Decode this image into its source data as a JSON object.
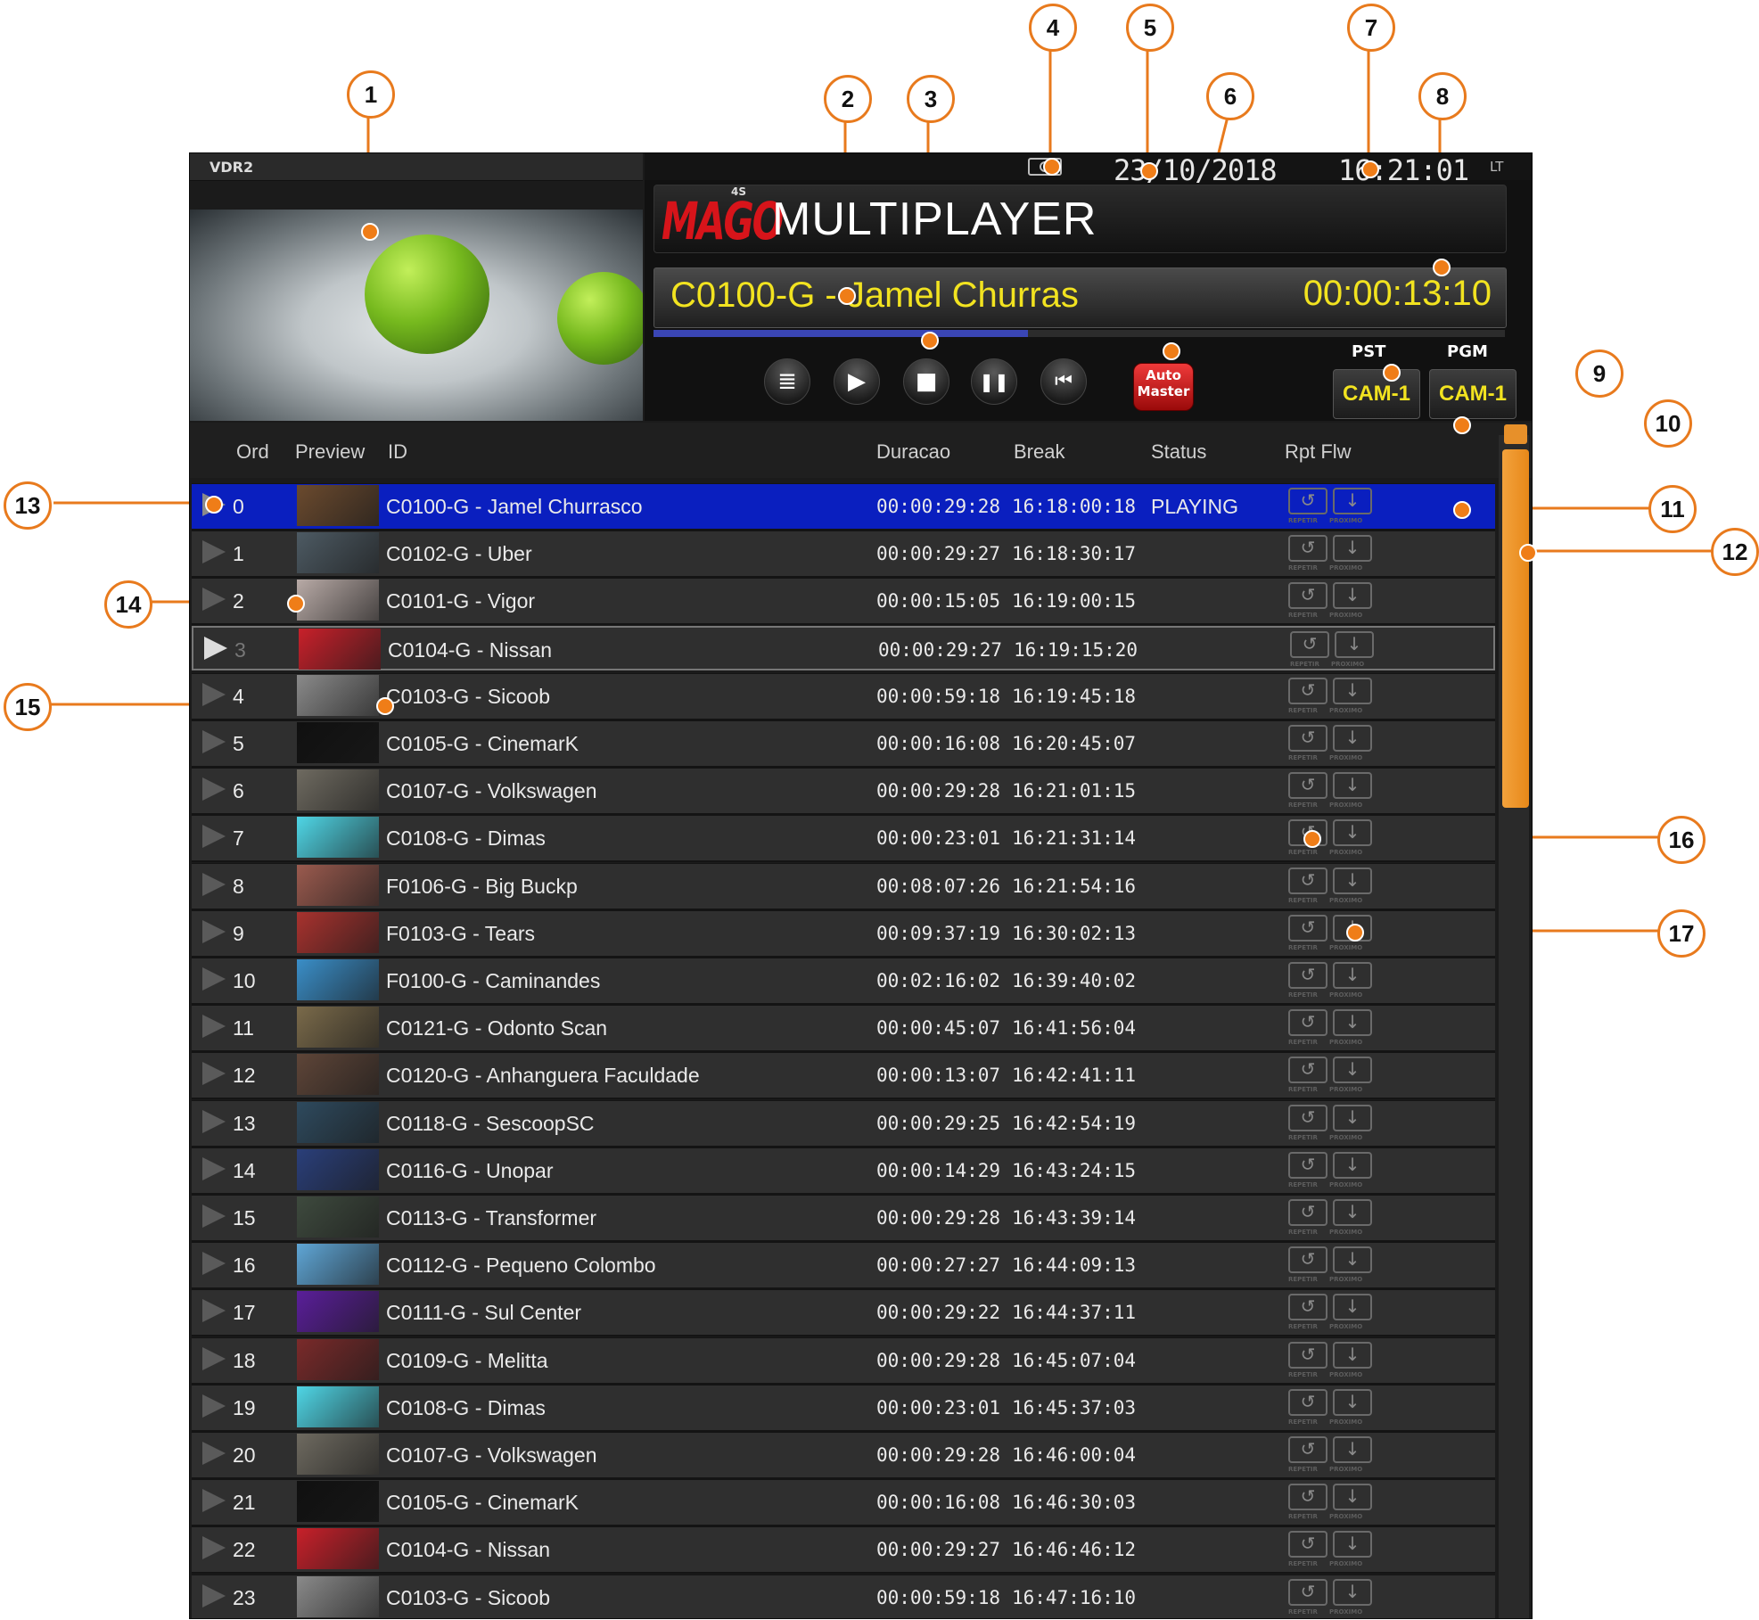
{
  "app": {
    "channel_label": "VDR2",
    "brand_logo": "MAGO",
    "brand_sup": "4S",
    "title": "MULTIPLAYER"
  },
  "status": {
    "date": "23/10/2018",
    "time": "16:21:01",
    "time_zone": "LT"
  },
  "now_playing": {
    "title": "C0100-G - Jamel Churras",
    "timer": "00:00:13:10",
    "progress": 0.44
  },
  "transport": {
    "list_glyph": "≣",
    "play_glyph": "▶",
    "stop_glyph": "■",
    "pause_glyph": "❚❚",
    "restart_glyph": "⏮",
    "auto_master_line1": "Auto",
    "auto_master_line2": "Master"
  },
  "routing": {
    "pst_label": "PST",
    "pgm_label": "PGM",
    "pst_value": "CAM-1",
    "pgm_value": "CAM-1"
  },
  "table": {
    "columns": {
      "ord": "Ord",
      "preview": "Preview",
      "id": "ID",
      "duration": "Duracao",
      "break": "Break",
      "status": "Status",
      "rpt_flw": "Rpt Flw"
    },
    "icon_captions": {
      "rpt": "REPETIR",
      "flw": "PROXIMO"
    },
    "rows": [
      {
        "ord": "0",
        "id": "C0100-G - Jamel Churrasco",
        "duration": "00:00:29:28",
        "break": "16:18:00:18",
        "status": "PLAYING",
        "thumb": "#6b4a2e"
      },
      {
        "ord": "1",
        "id": "C0102-G - Uber",
        "duration": "00:00:29:27",
        "break": "16:18:30:17",
        "status": "",
        "thumb": "#4d5a63"
      },
      {
        "ord": "2",
        "id": "C0101-G - Vigor",
        "duration": "00:00:15:05",
        "break": "16:19:00:15",
        "status": "",
        "thumb": "#b8aaa6"
      },
      {
        "ord": "3",
        "id": "C0104-G - Nissan",
        "duration": "00:00:29:27",
        "break": "16:19:15:20",
        "status": "",
        "thumb": "#c8202a"
      },
      {
        "ord": "4",
        "id": "C0103-G - Sicoob",
        "duration": "00:00:59:18",
        "break": "16:19:45:18",
        "status": "",
        "thumb": "#8a8a8a"
      },
      {
        "ord": "5",
        "id": "C0105-G - CinemarK",
        "duration": "00:00:16:08",
        "break": "16:20:45:07",
        "status": "",
        "thumb": "#101010"
      },
      {
        "ord": "6",
        "id": "C0107-G - Volkswagen",
        "duration": "00:00:29:28",
        "break": "16:21:01:15",
        "status": "",
        "thumb": "#6e6a60"
      },
      {
        "ord": "7",
        "id": "C0108-G - Dimas",
        "duration": "00:00:23:01",
        "break": "16:21:31:14",
        "status": "",
        "thumb": "#4fd6e6"
      },
      {
        "ord": "8",
        "id": "F0106-G - Big Buckp",
        "duration": "00:08:07:26",
        "break": "16:21:54:16",
        "status": "",
        "thumb": "#9a5a4e"
      },
      {
        "ord": "9",
        "id": "F0103-G - Tears",
        "duration": "00:09:37:19",
        "break": "16:30:02:13",
        "status": "",
        "thumb": "#a8322e"
      },
      {
        "ord": "10",
        "id": "F0100-G - Caminandes",
        "duration": "00:02:16:02",
        "break": "16:39:40:02",
        "status": "",
        "thumb": "#3a8ec8"
      },
      {
        "ord": "11",
        "id": "C0121-G - Odonto Scan",
        "duration": "00:00:45:07",
        "break": "16:41:56:04",
        "status": "",
        "thumb": "#7a6a4a"
      },
      {
        "ord": "12",
        "id": "C0120-G - Anhanguera Faculdade",
        "duration": "00:00:13:07",
        "break": "16:42:41:11",
        "status": "",
        "thumb": "#5e4538"
      },
      {
        "ord": "13",
        "id": "C0118-G - SescoopSC",
        "duration": "00:00:29:25",
        "break": "16:42:54:19",
        "status": "",
        "thumb": "#2e4a5e"
      },
      {
        "ord": "14",
        "id": "C0116-G - Unopar",
        "duration": "00:00:14:29",
        "break": "16:43:24:15",
        "status": "",
        "thumb": "#2a3f7a"
      },
      {
        "ord": "15",
        "id": "C0113-G - Transformer",
        "duration": "00:00:29:28",
        "break": "16:43:39:14",
        "status": "",
        "thumb": "#3e4a3e"
      },
      {
        "ord": "16",
        "id": "C0112-G - Pequeno Colombo",
        "duration": "00:00:27:27",
        "break": "16:44:09:13",
        "status": "",
        "thumb": "#5fa6d6"
      },
      {
        "ord": "17",
        "id": "C0111-G - Sul Center",
        "duration": "00:00:29:22",
        "break": "16:44:37:11",
        "status": "",
        "thumb": "#5a1e9a"
      },
      {
        "ord": "18",
        "id": "C0109-G - Melitta",
        "duration": "00:00:29:28",
        "break": "16:45:07:04",
        "status": "",
        "thumb": "#7a2a2a"
      },
      {
        "ord": "19",
        "id": "C0108-G - Dimas",
        "duration": "00:00:23:01",
        "break": "16:45:37:03",
        "status": "",
        "thumb": "#4fd6e6"
      },
      {
        "ord": "20",
        "id": "C0107-G - Volkswagen",
        "duration": "00:00:29:28",
        "break": "16:46:00:04",
        "status": "",
        "thumb": "#6e6a60"
      },
      {
        "ord": "21",
        "id": "C0105-G - CinemarK",
        "duration": "00:00:16:08",
        "break": "16:46:30:03",
        "status": "",
        "thumb": "#101010"
      },
      {
        "ord": "22",
        "id": "C0104-G - Nissan",
        "duration": "00:00:29:27",
        "break": "16:46:46:12",
        "status": "",
        "thumb": "#c8202a"
      },
      {
        "ord": "23",
        "id": "C0103-G - Sicoob",
        "duration": "00:00:59:18",
        "break": "16:47:16:10",
        "status": "",
        "thumb": "#8a8a8a"
      }
    ]
  },
  "callouts": [
    "1",
    "2",
    "3",
    "4",
    "5",
    "6",
    "7",
    "8",
    "9",
    "10",
    "11",
    "12",
    "13",
    "14",
    "15",
    "16",
    "17"
  ],
  "colors": {
    "accent": "#e87a1d",
    "playing_row": "#0a1fbf",
    "clip_text": "#f2e320",
    "logo_red": "#d7141a"
  }
}
